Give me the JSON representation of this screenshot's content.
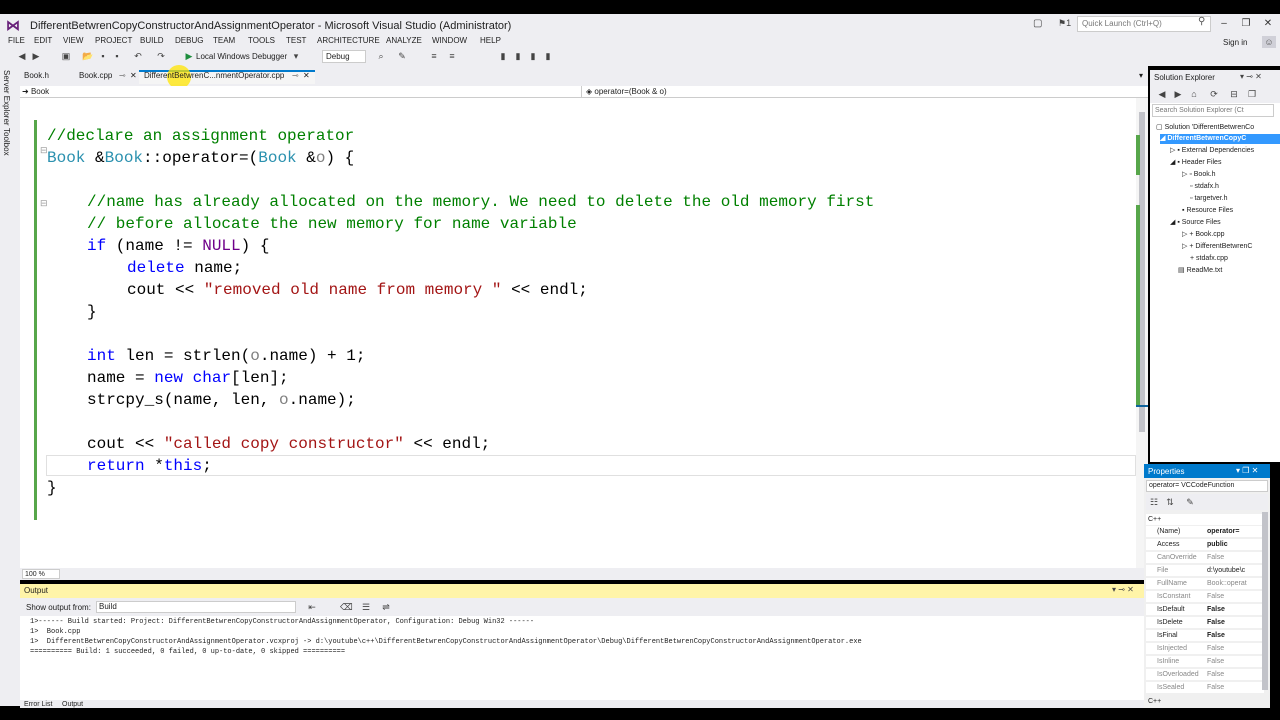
{
  "app": {
    "title": "DifferentBetwrenCopyConstructorAndAssignmentOperator - Microsoft Visual Studio (Administrator)",
    "quick_launch_placeholder": "Quick Launch (Ctrl+Q)",
    "notification_count": "1",
    "sign_in": "Sign in"
  },
  "menu": [
    "FILE",
    "EDIT",
    "VIEW",
    "PROJECT",
    "BUILD",
    "DEBUG",
    "TEAM",
    "TOOLS",
    "TEST",
    "ARCHITECTURE",
    "ANALYZE",
    "WINDOW",
    "HELP"
  ],
  "toolbar": {
    "debugger_label": "Local Windows Debugger",
    "configuration": "Debug"
  },
  "side_tabs": [
    "Server Explorer",
    "Toolbox"
  ],
  "doc_tabs": [
    {
      "label": "Book.h",
      "active": false
    },
    {
      "label": "Book.cpp",
      "active": false
    },
    {
      "label": "DifferentBetwrenC...nmentOperator.cpp",
      "active": true
    }
  ],
  "navbar": {
    "class_scope": "Book",
    "member_scope": "operator=(Book & o)"
  },
  "code_lines": [
    "//declare an assignment operator",
    "Book &Book::operator=(Book &o) {",
    "",
    "    //name has already allocated on the memory. We need to delete the old memory first",
    "    // before allocate the new memory for name variable",
    "    if (name != NULL) {",
    "        delete name;",
    "        cout << \"removed old name from memory \" << endl;",
    "    }",
    "",
    "    int len = strlen(o.name) + 1;",
    "    name = new char[len];",
    "    strcpy_s(name, len, o.name);",
    "",
    "    cout << \"called copy constructor\" << endl;",
    "    return *this;",
    "}"
  ],
  "code_text": {
    "comment_declare": "//declare an assignment operator",
    "kw_if": "if",
    "kw_delete": "delete",
    "kw_int": "int",
    "kw_new": "new",
    "kw_char": "char",
    "kw_return": "return",
    "kw_this": "this",
    "type_book": "Book",
    "null": "NULL",
    "str_removed": "\"removed old name from memory \"",
    "str_called": "\"called copy constructor\"",
    "comment_line1": "//name has already allocated on the memory. We need to delete the old memory first",
    "comment_line2": "// before allocate the new memory for name variable"
  },
  "zoom": "100 %",
  "output": {
    "title": "Output",
    "show_output_from_label": "Show output from:",
    "source": "Build",
    "lines": [
      "1>------ Build started: Project: DifferentBetwrenCopyConstructorAndAssignmentOperator, Configuration: Debug Win32 ------",
      "1>  Book.cpp",
      "1>  DifferentBetwrenCopyConstructorAndAssignmentOperator.vcxproj -> d:\\youtube\\c++\\DifferentBetwrenCopyConstructorAndAssignmentOperator\\Debug\\DifferentBetwrenCopyConstructorAndAssignmentOperator.exe",
      "========== Build: 1 succeeded, 0 failed, 0 up-to-date, 0 skipped =========="
    ]
  },
  "bottom_tabs": [
    "Error List",
    "Output"
  ],
  "solution_explorer": {
    "title": "Solution Explorer",
    "search_placeholder": "Search Solution Explorer (Ct",
    "tree": [
      {
        "label": "Solution 'DifferentBetwrenCo",
        "depth": 0
      },
      {
        "label": "DifferentBetwrenCopyC",
        "depth": 1,
        "bold": true
      },
      {
        "label": "External Dependencies",
        "depth": 2
      },
      {
        "label": "Header Files",
        "depth": 2
      },
      {
        "label": "Book.h",
        "depth": 3
      },
      {
        "label": "stdafx.h",
        "depth": 3
      },
      {
        "label": "targetver.h",
        "depth": 3
      },
      {
        "label": "Resource Files",
        "depth": 2
      },
      {
        "label": "Source Files",
        "depth": 2
      },
      {
        "label": "Book.cpp",
        "depth": 3
      },
      {
        "label": "DifferentBetwrenC",
        "depth": 3
      },
      {
        "label": "stdafx.cpp",
        "depth": 3
      },
      {
        "label": "ReadMe.txt",
        "depth": 2
      }
    ]
  },
  "properties": {
    "title": "Properties",
    "object": "operator=  VCCodeFunction",
    "category": "C++",
    "footer": "C++",
    "rows": [
      {
        "name": "(Name)",
        "value": "operator=",
        "bold": true
      },
      {
        "name": "Access",
        "value": "public",
        "bold": true
      },
      {
        "name": "CanOverride",
        "value": "False",
        "dim": true
      },
      {
        "name": "File",
        "value": "d:\\youtube\\c",
        "dim": false
      },
      {
        "name": "FullName",
        "value": "Book::operat",
        "dim": true
      },
      {
        "name": "IsConstant",
        "value": "False",
        "dim": true
      },
      {
        "name": "IsDefault",
        "value": "False",
        "bold": true
      },
      {
        "name": "IsDelete",
        "value": "False",
        "bold": true
      },
      {
        "name": "IsFinal",
        "value": "False",
        "bold": true
      },
      {
        "name": "IsInjected",
        "value": "False",
        "dim": true
      },
      {
        "name": "IsInline",
        "value": "False",
        "dim": true
      },
      {
        "name": "IsOverloaded",
        "value": "False",
        "dim": true
      },
      {
        "name": "IsSealed",
        "value": "False",
        "dim": true
      }
    ]
  }
}
